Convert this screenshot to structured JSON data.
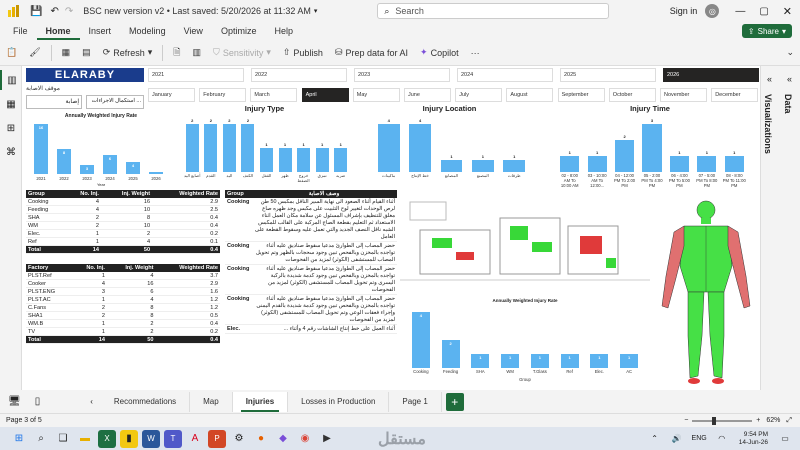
{
  "titlebar": {
    "doc_title": "BSC new version v2 • Last saved: 5/20/2026 at 11:32 AM",
    "search_placeholder": "Search",
    "sign_in": "Sign in"
  },
  "menu": [
    "File",
    "Home",
    "Insert",
    "Modeling",
    "View",
    "Optimize",
    "Help"
  ],
  "share_label": "Share",
  "ribbon": {
    "refresh": "Refresh",
    "sensitivity": "Sensitivity",
    "publish": "Publish",
    "prep_ai": "Prep data for AI",
    "copilot": "Copilot"
  },
  "logo_text": "ELARABY",
  "filters": {
    "label": "موقف الاصابة",
    "value1": "إصابة",
    "value2": "استكمال الاجراءات ..."
  },
  "years": [
    "2021",
    "2022",
    "2023",
    "2024",
    "2025",
    "2026"
  ],
  "selected_year": "2026",
  "months": [
    "January",
    "February",
    "March",
    "April",
    "May",
    "June",
    "July",
    "August",
    "September",
    "October",
    "November",
    "December"
  ],
  "selected_month": "April",
  "annual_chart": {
    "title": "Annually Weighted Injury Rate",
    "xlabel": "Year",
    "categories": [
      "2021",
      "2022",
      "2023",
      "2024",
      "2025",
      "2026"
    ],
    "labels": [
      "16",
      "8",
      "3",
      "6",
      "4",
      ""
    ],
    "values": [
      16,
      8,
      3,
      6,
      4,
      0.4
    ]
  },
  "chart_data": [
    {
      "type": "bar",
      "title": "Injury Type",
      "categories": [
        "أصابع اليد",
        "القدم",
        "اليد",
        "الكتف",
        "القفل",
        "ظهر",
        "خروج الضفط",
        "تمزق",
        "ضربه"
      ],
      "values": [
        2,
        2,
        2,
        2,
        1,
        1,
        1,
        1,
        1
      ]
    },
    {
      "type": "bar",
      "title": "Injury Location",
      "categories": [
        "ماكينات",
        "خط الإنتاج",
        "المصانع",
        "المصنع",
        "طرقات"
      ],
      "values": [
        4,
        4,
        1,
        1,
        1
      ]
    },
    {
      "type": "bar",
      "title": "Injury Time",
      "categories": [
        "02 - 8:00 AM To 10:00 AM",
        "03 - 10:00 AM To 12:00...",
        "04 - 12:00 PM To 2:00 PM",
        "05 - 2:00 PM To 4:00 PM",
        "06 - 4:00 PM To 5:00 PM",
        "07 - 5:00 PM To 8:00 PM",
        "08 - 8:00 PM To 11:00 PM"
      ],
      "values": [
        1,
        1,
        2,
        3,
        1,
        1,
        1
      ]
    },
    {
      "type": "bar",
      "title": "Annually Weighted Injury Rate",
      "xlabel": "Group",
      "categories": [
        "Cooking",
        "Feeding",
        "SHA",
        "WM",
        "T.Glass",
        "Ref",
        "Elec.",
        "AC"
      ],
      "values": [
        4,
        2,
        1,
        1,
        1,
        1,
        1,
        1
      ]
    }
  ],
  "group_table": {
    "headers": [
      "Group",
      "No. Inj.",
      "Inj. Weight",
      "Weighted Rate"
    ],
    "rows": [
      [
        "Cooking",
        "4",
        "16",
        "2.9"
      ],
      [
        "Feeding",
        "4",
        "10",
        "2.5"
      ],
      [
        "SHA",
        "2",
        "8",
        "0.4"
      ],
      [
        "WM",
        "2",
        "10",
        "0.4"
      ],
      [
        "Elec.",
        "1",
        "2",
        "0.2"
      ],
      [
        "Ref",
        "1",
        "4",
        "0.1"
      ]
    ],
    "total": [
      "Total",
      "14",
      "50",
      "0.4"
    ]
  },
  "factory_table": {
    "headers": [
      "Factory",
      "No. Inj.",
      "Inj. Weight",
      "Weighted Rate"
    ],
    "rows": [
      [
        "PLST.Ref",
        "1",
        "4",
        "3.7"
      ],
      [
        "Cooker",
        "4",
        "16",
        "2.9"
      ],
      [
        "PLST.ENG",
        "3",
        "6",
        "1.6"
      ],
      [
        "PLST.AC",
        "1",
        "4",
        "1.2"
      ],
      [
        "C.Fans",
        "2",
        "8",
        "1.2"
      ],
      [
        "SHA1",
        "2",
        "8",
        "0.5"
      ],
      [
        "WM.B",
        "1",
        "2",
        "0.4"
      ],
      [
        "TV",
        "1",
        "2",
        "0.2"
      ]
    ],
    "total": [
      "Total",
      "14",
      "50",
      "0.4"
    ]
  },
  "desc_table": {
    "headers": [
      "Group",
      "وصف الاصابة"
    ],
    "rows": [
      [
        "Cooking",
        "أثناء القيام أثناء الصعود الى نهاية السير الناقل بمكبس 50 طن لرص الوحدات لتغيير لوح التثبيت على مكبس وجد ظهره صاع مغلق للتنظيف بإشراف المسئول عن سلامة مكان العمل اثناء الاستعداد ثم التعليم بقطعة الصاج المركبة على القالب للمكبس الشبه ناقل النصف الجديد والتي تعمل عليه وسقوط القطعة على العامل"
      ],
      [
        "Cooking",
        "حضر المصاب إلى الطوارئ مدعيا سقوط صناديق عليه أثناء تواجده بالمخزن وبالفحص تبين وجود سحجات بالظهر وتم تحويل المصاب للمستشفى (الكوثر) لمزيد من الفحوصات"
      ],
      [
        "Cooking",
        "حضر المصاب إلى الطوارئ مدعيا سقوط صناديق عليه أثناء تواجده بالمخزن وبالفحص تبين وجود كدمة شديدة بالركبة اليسرى وتم تحويل المصاب للمستشفى (الكوثر) لمزيد من الفحوصات"
      ],
      [
        "Cooking",
        "حضر المصاب إلى الطوارئ مدعيا سقوط صناديق عليه أثناء تواجده بالمخزن وبالفحص تبين وجود كدمة شديدة بالقدم اليمنى وإجراء فعقات الوعي وتم تحويل المصاب للمستشفى (الكوثر) لمزيد من الفحوصات"
      ],
      [
        "Elec.",
        "أثناء العمل على خط إنتاج الشاشات رقم 4 وأثناء ..."
      ]
    ]
  },
  "page_tabs": [
    "Recommedations",
    "Map",
    "Injuries",
    "Losses in Production",
    "Page 1"
  ],
  "active_tab": "Injuries",
  "status": {
    "page": "Page 3 of 5",
    "zoom": "62%"
  },
  "right_pane": {
    "data": "Data",
    "visualizations": "Visualizations"
  },
  "taskbar": {
    "lang": "ENG",
    "time": "9:54 PM",
    "date": "14-Jun-26",
    "watermark": "مستقل"
  },
  "colors": {
    "bar": "#5bb3f0",
    "accent": "#1f6c3b",
    "logo_bg": "#1a3c8c",
    "body_green": "#46e046",
    "body_red": "#e03a3a"
  }
}
